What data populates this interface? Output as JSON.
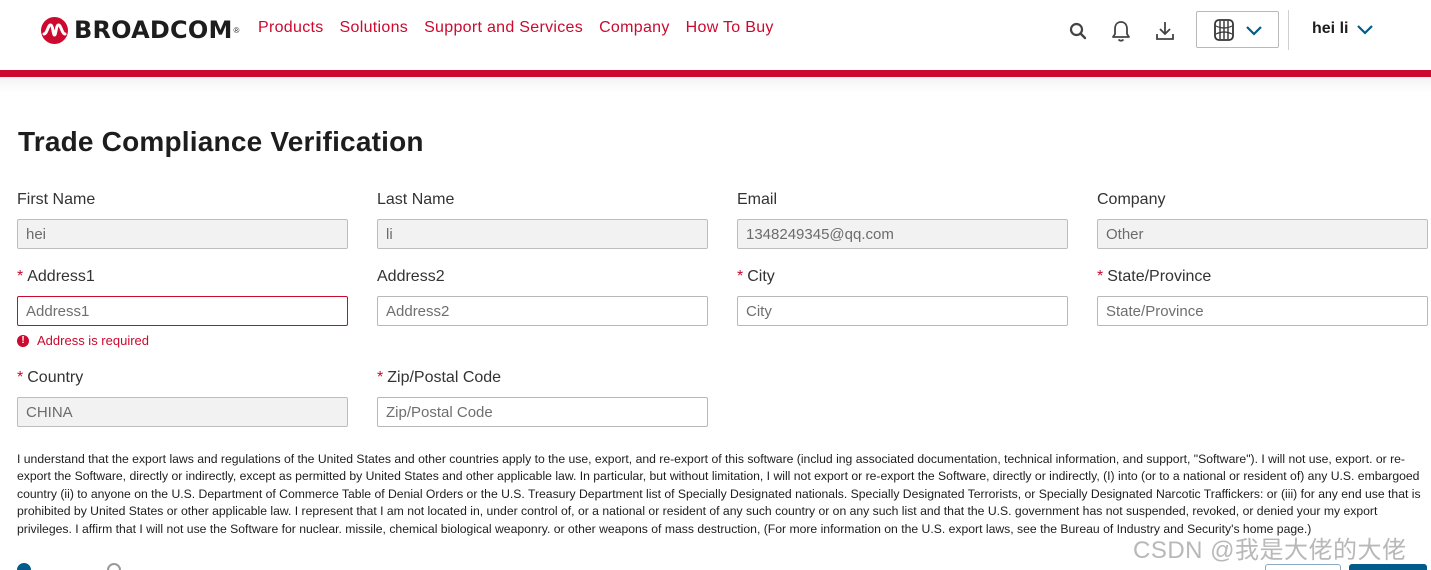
{
  "header": {
    "brand": "BROADCOM",
    "brand_mark": "®",
    "nav": [
      "Products",
      "Solutions",
      "Support and Services",
      "Company",
      "How To Buy"
    ],
    "icons": [
      "search-icon",
      "bell-icon",
      "download-icon",
      "globe-icon",
      "chevron-down-icon"
    ],
    "user_name": "hei li",
    "accent_color": "#cc092f"
  },
  "page": {
    "title": "Trade Compliance Verification"
  },
  "form": {
    "first_name": {
      "label": "First Name",
      "value": "hei"
    },
    "last_name": {
      "label": "Last Name",
      "value": "li"
    },
    "email": {
      "label": "Email",
      "value": "1348249345@qq.com"
    },
    "company": {
      "label": "Company",
      "value": "Other"
    },
    "address1": {
      "label": "Address1",
      "placeholder": "Address1",
      "error": "Address is required"
    },
    "address2": {
      "label": "Address2",
      "placeholder": "Address2"
    },
    "city": {
      "label": "City",
      "placeholder": "City"
    },
    "state": {
      "label": "State/Province",
      "placeholder": "State/Province"
    },
    "country": {
      "label": "Country",
      "value": "CHINA"
    },
    "zip": {
      "label": "Zip/Postal Code",
      "placeholder": "Zip/Postal Code"
    },
    "required_marker": "*"
  },
  "legal_text": "I understand that the export laws and regulations of the United States and other countries apply to the use, export, and re-export of this software (includ ing associated documentation, technical information, and support, \"Software\"). I will not use, export. or re-export the Software, directly or indirectly, except as permitted by United States and other applicable law. In particular, but without limitation, I will not export or re-export the Software, directly or indirectly, (I) into (or to a national or resident of) any U.S. embargoed country (ii) to anyone on the U.S. Department of Commerce Table of Denial Orders or the U.S. Treasury Department list of Specially Designated nationals. Specially Designated Terrorists, or Specially Designated Narcotic Traffickers: or (iii) for any end use that is prohibited by United States or other applicable law. I represent that I am not located in, under control of, or a national or resident of any such country or on any such list and that the U.S. government has not suspended, revoked, or denied your my export privileges. I affirm that I will not use the Software for nuclear. missile, chemical biological weaponry. or other weapons of mass destruction, (For more information on the U.S. export laws, see the Bureau of Industry and Security's home page.)",
  "watermark": "CSDN @我是大佬的大佬"
}
